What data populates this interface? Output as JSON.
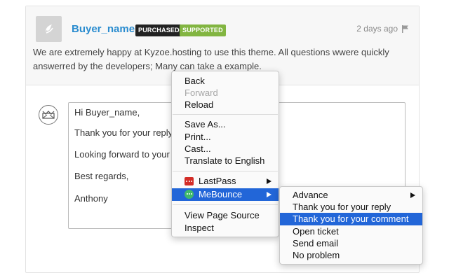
{
  "review": {
    "buyer_name": "Buyer_name",
    "badge_purchased": "PURCHASED",
    "badge_supported": "SUPPORTED",
    "time_ago": "2 days ago",
    "text": "We are extremely happy at Kyzoe.hosting to use this theme. All questions wwere quickly answerred by the developers; Many can take a example."
  },
  "reply": {
    "lines": [
      "Hi Buyer_name,",
      "Thank you for your reply.",
      "Looking forward to your",
      "Best regards,",
      "Anthony"
    ]
  },
  "context_menu": {
    "back": "Back",
    "forward": "Forward",
    "reload": "Reload",
    "save_as": "Save As...",
    "print": "Print...",
    "cast": "Cast...",
    "translate": "Translate to English",
    "lastpass": "LastPass",
    "mebounce": "MeBounce",
    "view_source": "View Page Source",
    "inspect": "Inspect"
  },
  "submenu": {
    "items": [
      "Advance",
      "Thank you for your reply",
      "Thank you for your comment",
      "Open ticket",
      "Send email",
      "No problem"
    ],
    "highlighted": "Thank you for your comment"
  },
  "colors": {
    "buyer_name": "#2a8ccf",
    "purchased_badge": "#222222",
    "supported_badge": "#82b541",
    "menu_highlight": "#2266d8",
    "lastpass": "#d32d27",
    "mebounce": "#3fb96b"
  },
  "icons": [
    "avatar-logo-icon",
    "flag-icon",
    "envelope-crown-icon",
    "lastpass-icon",
    "mebounce-icon",
    "submenu-arrow-icon"
  ]
}
